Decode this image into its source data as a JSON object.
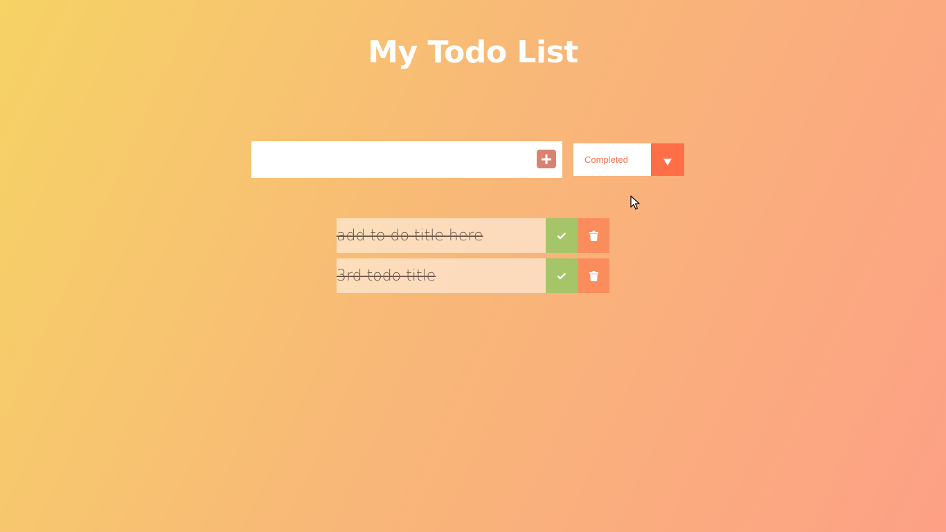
{
  "header": {
    "title": "My Todo List"
  },
  "new_todo": {
    "value": "",
    "placeholder": "",
    "add_icon": "plus-icon"
  },
  "filter": {
    "selected": "Completed",
    "arrow_icon": "caret-down-icon"
  },
  "todos": [
    {
      "title": "add to do title here",
      "completed": true,
      "check_icon": "check-icon",
      "delete_icon": "trash-icon"
    },
    {
      "title": "3rd todo title",
      "completed": true,
      "check_icon": "check-icon",
      "delete_icon": "trash-icon"
    }
  ],
  "colors": {
    "gradient_start": "#f6d365",
    "gradient_end": "#fda085",
    "add_button": "#d88370",
    "accent": "#ff6f47",
    "complete_button": "#a6c468",
    "delete_button": "#fb8d5c"
  }
}
